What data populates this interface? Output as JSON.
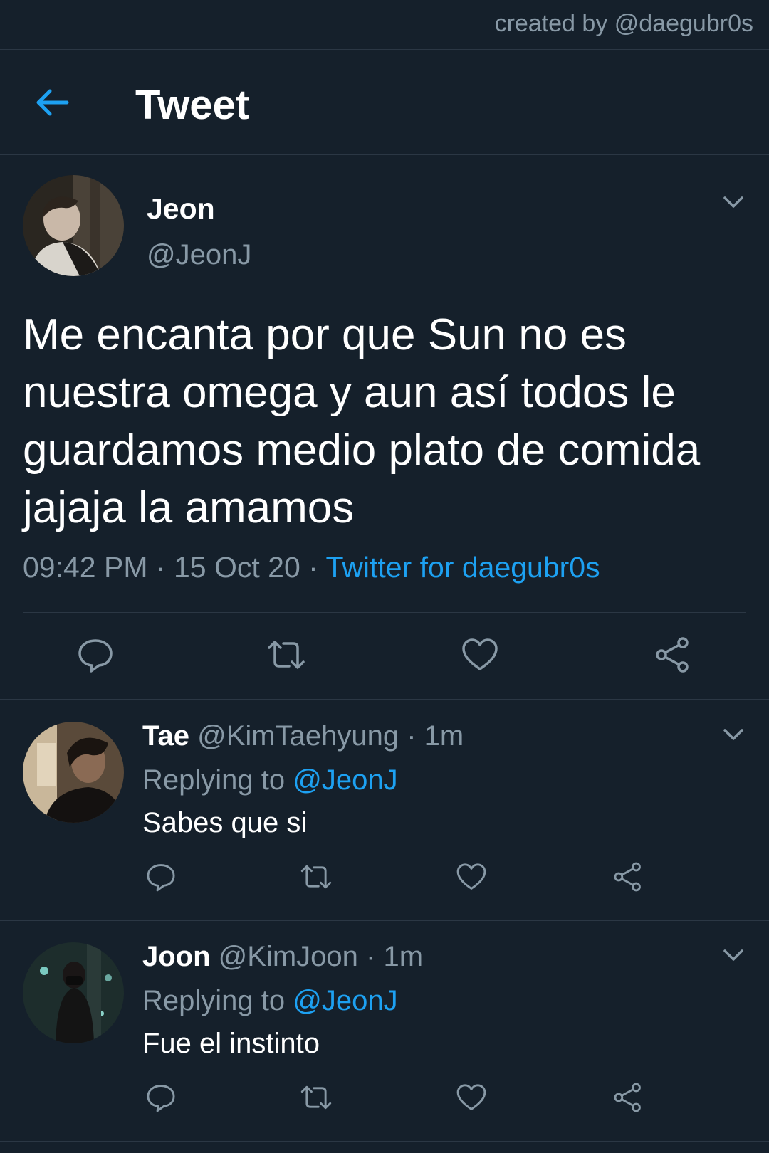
{
  "credit": "created by @daegubr0s",
  "header": {
    "title": "Tweet",
    "back_icon": "arrow-left-icon"
  },
  "colors": {
    "background": "#15202b",
    "accent": "#1da1f2",
    "secondary_text": "#8899a6",
    "divider": "#2b3744"
  },
  "main_tweet": {
    "name": "Jeon",
    "handle": "@JeonJ",
    "text": "Me encanta por que Sun no es nuestra omega y aun así todos le guardamos medio plato de comida jajaja la amamos",
    "time": "09:42 PM",
    "date": "15 Oct 20",
    "separator": "·",
    "source": "Twitter for daegubr0s"
  },
  "replies": [
    {
      "name": "Tae",
      "handle": "@KimTaehyung",
      "dot": "·",
      "age": "1m",
      "replying_prefix": "Replying to",
      "replying_to": "@JeonJ",
      "text": "Sabes que si"
    },
    {
      "name": "Joon",
      "handle": "@KimJoon",
      "dot": "·",
      "age": "1m",
      "replying_prefix": "Replying to",
      "replying_to": "@JeonJ",
      "text": "Fue el instinto"
    }
  ]
}
